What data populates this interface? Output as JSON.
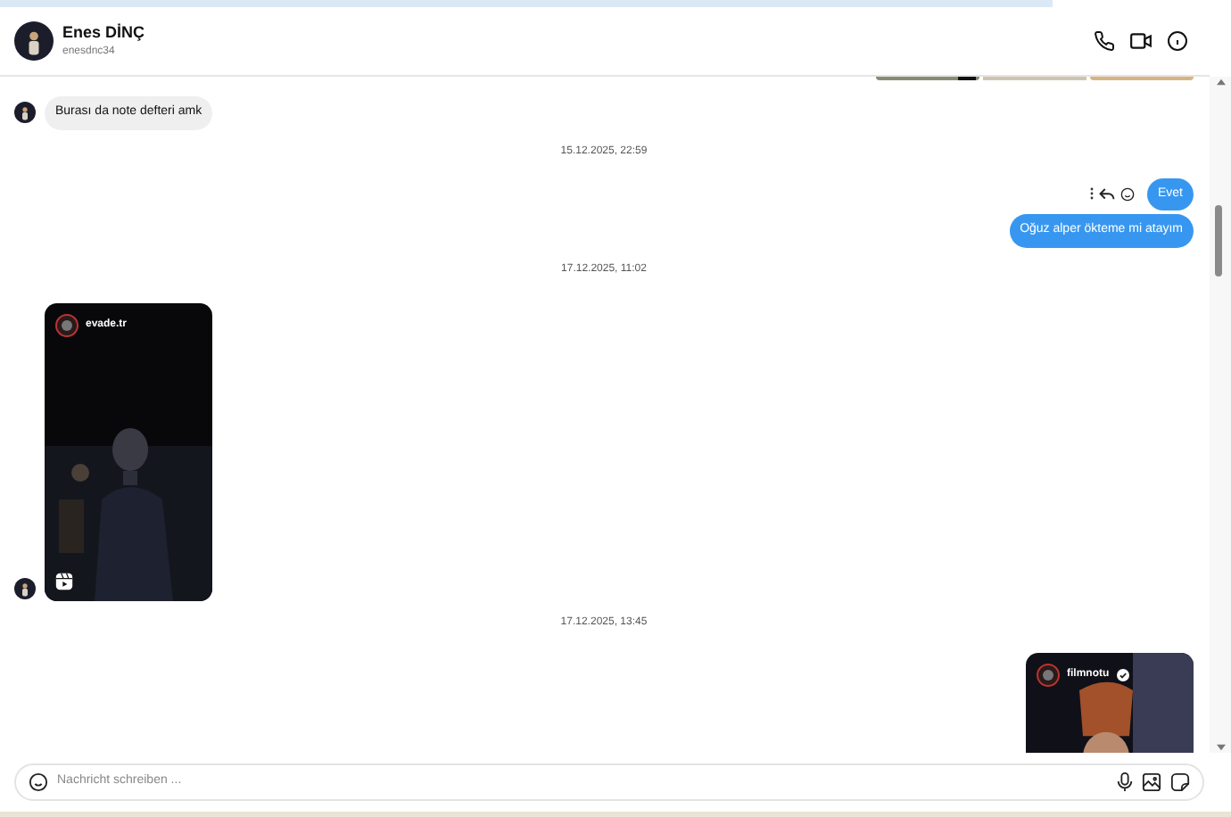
{
  "contact": {
    "name": "Enes DİNÇ",
    "username": "enesdnc34"
  },
  "messages": [
    {
      "kind": "strip",
      "outgoing": true
    },
    {
      "kind": "text",
      "outgoing": false,
      "text": "Burası da note defteri amk",
      "actions_shown": false
    },
    {
      "kind": "date",
      "text": "15.12.2025, 22:59"
    },
    {
      "kind": "text",
      "outgoing": true,
      "text": "Evet",
      "actions_shown": true
    },
    {
      "kind": "text",
      "outgoing": true,
      "text": "Oğuz alper ökteme mi atayım",
      "actions_shown": false
    },
    {
      "kind": "date",
      "text": "17.12.2025, 11:02"
    },
    {
      "kind": "reel",
      "outgoing": false,
      "account": "evade.tr",
      "verified": false
    },
    {
      "kind": "date",
      "text": "17.12.2025, 13:45"
    },
    {
      "kind": "reel",
      "outgoing": true,
      "account": "filmnotu",
      "verified": true
    }
  ],
  "composer": {
    "placeholder": "Nachricht schreiben ..."
  }
}
